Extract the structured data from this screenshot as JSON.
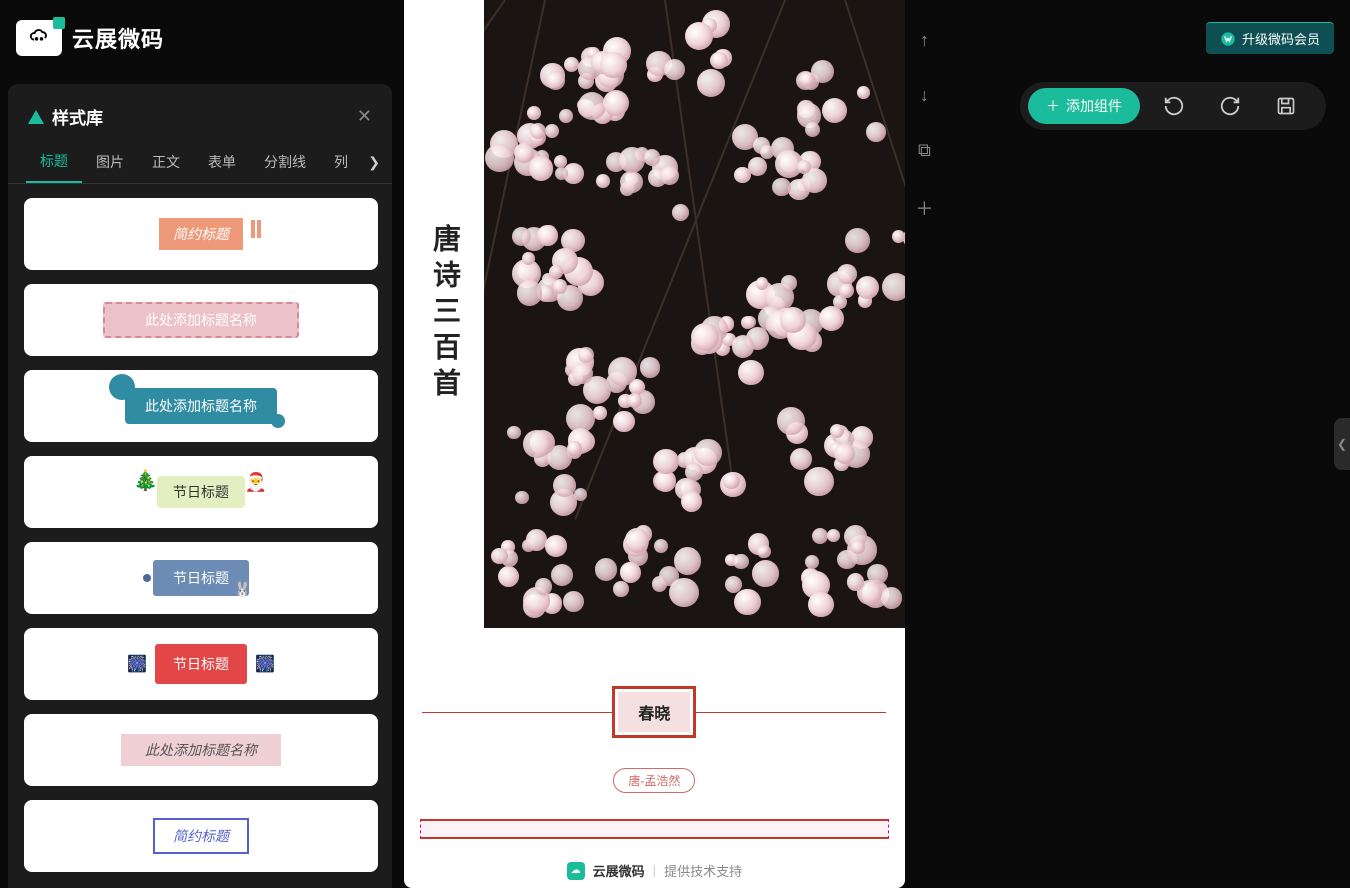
{
  "brand": "云展微码",
  "upgrade_label": "升级微码会员",
  "panel": {
    "title": "样式库",
    "tabs": [
      "标题",
      "图片",
      "正文",
      "表单",
      "分割线",
      "列"
    ],
    "active_tab_index": 0,
    "samples": [
      "简约标题",
      "此处添加标题名称",
      "此处添加标题名称",
      "节日标题",
      "节日标题",
      "节日标题",
      "此处添加标题名称",
      "简约标题"
    ]
  },
  "toolbar": {
    "add_label": "添加组件"
  },
  "canvas": {
    "spine_text": "唐诗三百首",
    "poem_title": "春晓",
    "poem_author": "唐-孟浩然",
    "footer_brand": "云展微码",
    "footer_suffix": "提供技术支持"
  }
}
